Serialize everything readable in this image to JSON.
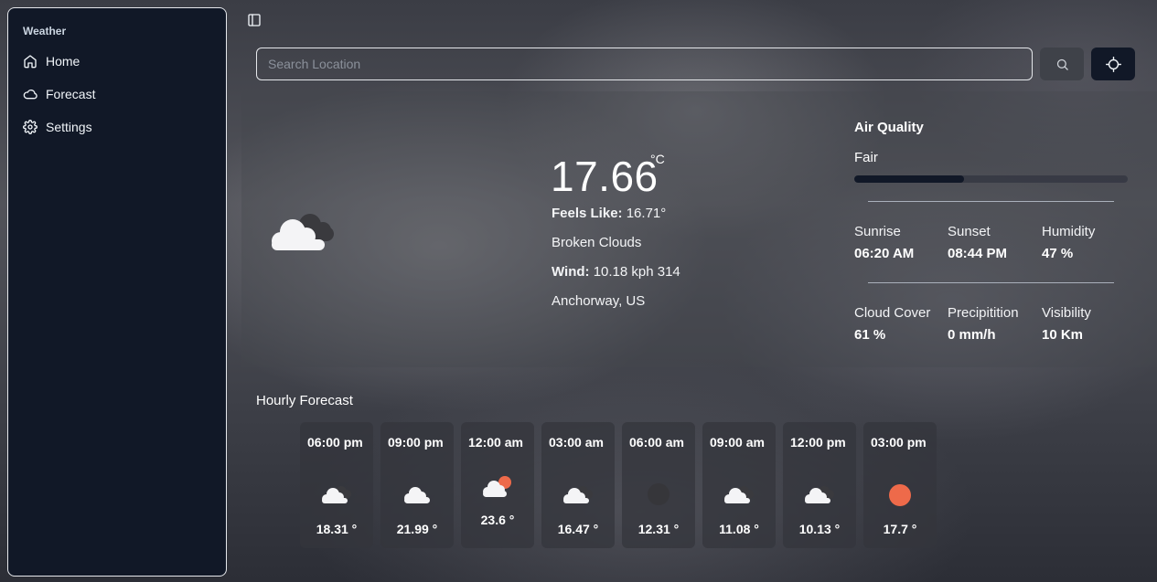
{
  "sidebar": {
    "group_label": "Weather",
    "items": [
      {
        "label": "Home",
        "icon": "home-icon"
      },
      {
        "label": "Forecast",
        "icon": "cloud-icon"
      },
      {
        "label": "Settings",
        "icon": "gear-icon"
      }
    ]
  },
  "search": {
    "placeholder": "Search Location"
  },
  "current": {
    "temperature": "17.66",
    "unit": "°C",
    "feels_like_label": "Feels Like:",
    "feels_like_value": "16.71°",
    "condition": "Broken Clouds",
    "wind_label": "Wind:",
    "wind_value": "10.18 kph 314",
    "location": "Anchorway, US",
    "icon": "broken-clouds-icon"
  },
  "air_quality": {
    "title": "Air Quality",
    "value": "Fair",
    "level_fraction": 0.4
  },
  "stats": [
    {
      "label": "Sunrise",
      "value": "06:20 AM"
    },
    {
      "label": "Sunset",
      "value": "08:44 PM"
    },
    {
      "label": "Humidity",
      "value": "47 %"
    },
    {
      "label": "Cloud Cover",
      "value": "61 %"
    },
    {
      "label": "Precipitition",
      "value": "0 mm/h"
    },
    {
      "label": "Visibility",
      "value": "10 Km"
    }
  ],
  "hourly": {
    "title": "Hourly Forecast",
    "items": [
      {
        "time": "06:00 pm",
        "temp": "18.31 °",
        "icon": "broken-clouds-icon"
      },
      {
        "time": "09:00 pm",
        "temp": "21.99 °",
        "icon": "cloud-icon"
      },
      {
        "time": "12:00 am",
        "temp": "23.6 °",
        "icon": "cloud-sun-icon"
      },
      {
        "time": "03:00 am",
        "temp": "16.47 °",
        "icon": "broken-clouds-icon"
      },
      {
        "time": "06:00 am",
        "temp": "12.31 °",
        "icon": "dark-cloud-icon"
      },
      {
        "time": "09:00 am",
        "temp": "11.08 °",
        "icon": "broken-clouds-icon"
      },
      {
        "time": "12:00 pm",
        "temp": "10.13 °",
        "icon": "broken-clouds-icon"
      },
      {
        "time": "03:00 pm",
        "temp": "17.7 °",
        "icon": "sun-icon"
      }
    ]
  },
  "colors": {
    "accent": "#111827",
    "sun": "#ee6a4a"
  }
}
